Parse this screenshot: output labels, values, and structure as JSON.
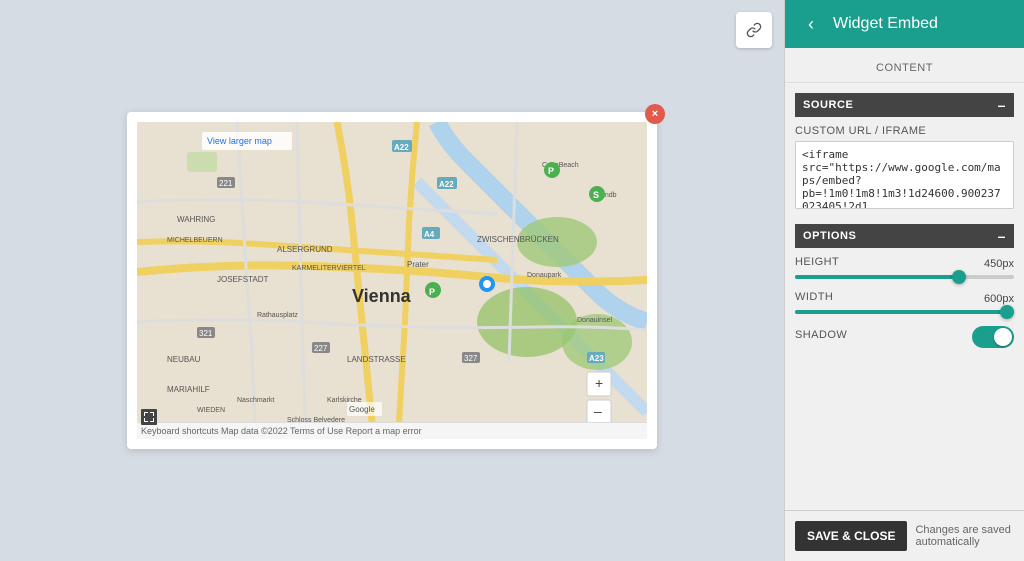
{
  "header": {
    "title": "Widget Embed",
    "back_label": "‹",
    "link_icon": "🔗"
  },
  "tabs": [
    {
      "label": "CONTENT",
      "active": true
    }
  ],
  "sections": {
    "source": {
      "label": "SOURCE",
      "collapse_icon": "–"
    },
    "options": {
      "label": "OPTIONS",
      "collapse_icon": "–"
    }
  },
  "fields": {
    "custom_url_label": "CUSTOM URL / IFRAME",
    "custom_url_value": "<iframe\nsrc=\"https://www.google.com/maps/embed?\npb=!1m0!1m8!1m3!1d24600.900237023405!2d1",
    "height_label": "HEIGHT",
    "height_value": "450px",
    "height_percent": 75,
    "width_label": "WIDTH",
    "width_value": "600px",
    "width_percent": 100,
    "shadow_label": "SHADOW",
    "shadow_enabled": true
  },
  "footer": {
    "save_close_label": "SAVE & CLOSE",
    "auto_save_text": "Changes are saved automatically"
  },
  "map_card": {
    "close_icon": "×",
    "zoom_in": "+",
    "zoom_out": "–",
    "footer_text": "Keyboard shortcuts   Map data ©2022   Terms of Use   Report a map error",
    "view_larger_label": "View larger map"
  }
}
